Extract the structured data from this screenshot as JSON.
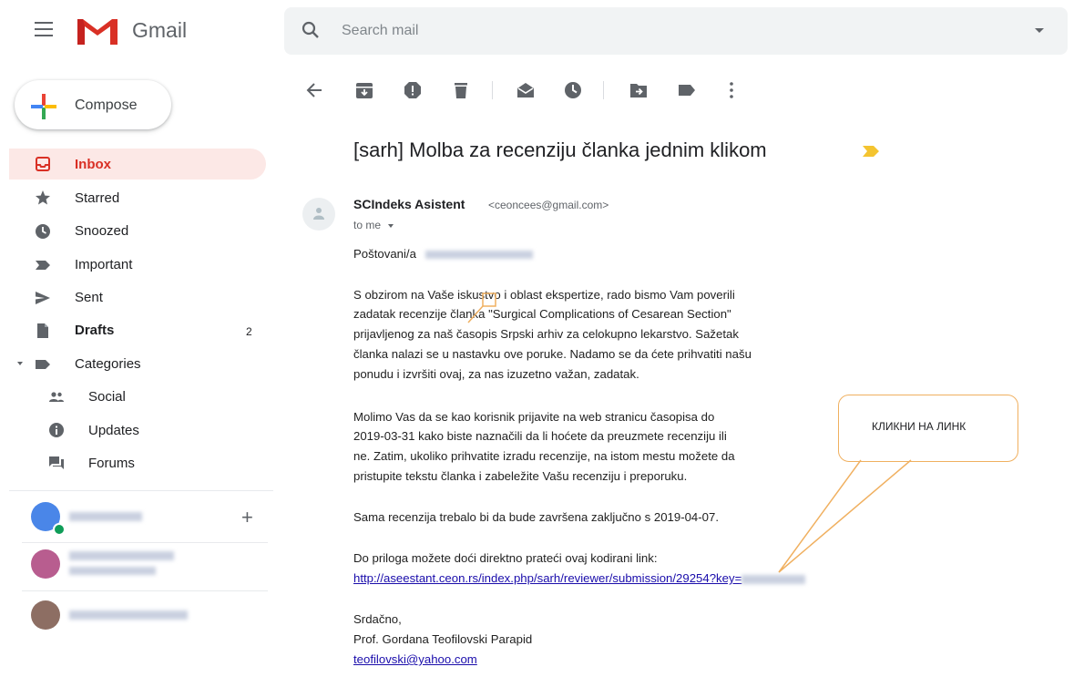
{
  "header": {
    "app_name": "Gmail",
    "search_placeholder": "Search mail"
  },
  "compose": {
    "label": "Compose"
  },
  "sidebar": {
    "items": [
      {
        "label": "Inbox",
        "icon": "inbox-icon",
        "active": true
      },
      {
        "label": "Starred",
        "icon": "star-icon"
      },
      {
        "label": "Snoozed",
        "icon": "clock-icon"
      },
      {
        "label": "Important",
        "icon": "important-icon"
      },
      {
        "label": "Sent",
        "icon": "send-icon"
      },
      {
        "label": "Drafts",
        "icon": "draft-icon",
        "count": "2"
      },
      {
        "label": "Categories",
        "icon": "label-icon"
      },
      {
        "label": "Social",
        "icon": "people-icon"
      },
      {
        "label": "Updates",
        "icon": "info-icon"
      },
      {
        "label": "Forums",
        "icon": "forum-icon"
      }
    ],
    "add_label": "+"
  },
  "toolbar": {
    "icons": [
      "back-icon",
      "archive-icon",
      "report-spam-icon",
      "delete-icon",
      "mark-unread-icon",
      "snooze-icon",
      "move-to-icon",
      "label-icon",
      "more-icon"
    ]
  },
  "message": {
    "subject": "[sarh] Molba za recenziju članka jednim klikom",
    "sender_name": "SCIndeks Asistent",
    "sender_email": "<ceoncees@gmail.com>",
    "to": "to me",
    "greeting": "Poštovani/a",
    "paragraph1": [
      "S obzirom na Vaše iskustvo i oblast ekspertize, rado bismo Vam poverili",
      "zadatak recenzije članka \"Surgical Complications of Cesarean Section\"",
      "prijavljenog za naš časopis Srpski arhiv za celokupno lekarstvo. Sažetak",
      "članka nalazi se u nastavku ove poruke. Nadamo se da ćete prihvatiti našu",
      "ponudu i izvršiti ovaj, za nas izuzetno važan, zadatak."
    ],
    "paragraph2": [
      "Molimo Vas da se kao korisnik prijavite na web stranicu časopisa do",
      "2019-03-31 kako biste naznačili da li hoćete da preuzmete recenziju ili",
      "ne. Zatim, ukoliko prihvatite izradu recenzije, na istom mestu možete da",
      "pristupite tekstu članka i zabeležite Vašu recenziju i preporuku."
    ],
    "paragraph3": "Sama recenzija trebalo bi da bude završena zaključno s 2019-04-07.",
    "paragraph4": "Do priloga možete doći direktno prateći ovaj kodirani link:",
    "link": "http://aseestant.ceon.rs/index.php/sarh/reviewer/submission/29254?key=",
    "closing": "Srdačno,",
    "signature": "Prof. Gordana Teofilovski Parapid",
    "signature_email": "teofilovski@yahoo.com"
  },
  "annotation": {
    "callout_text": "КЛИКНИ НА ЛИНК"
  },
  "colors": {
    "accent_red": "#d93025",
    "active_bg": "#fce8e6",
    "link": "#1a0dab",
    "callout": "#f0b060"
  }
}
